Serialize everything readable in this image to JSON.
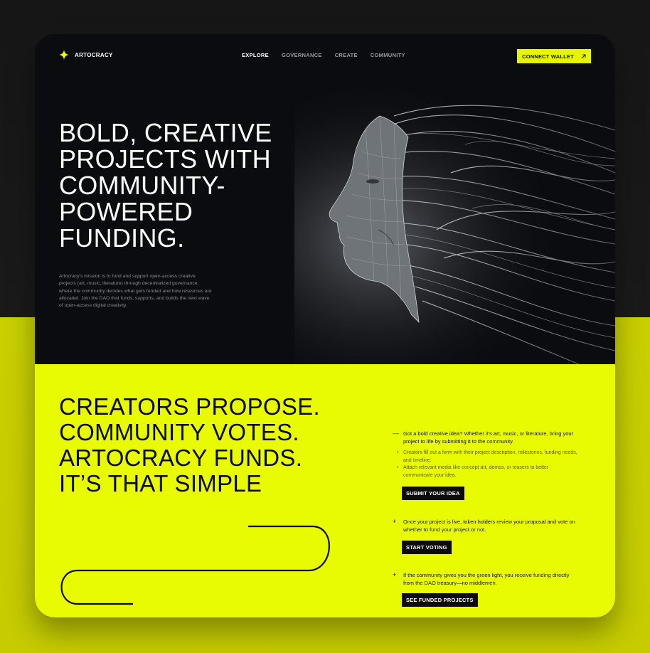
{
  "brand": {
    "name": "ARTOCRACY",
    "icon": "four-point-star-icon",
    "accent_color": "#e8fb00"
  },
  "nav": {
    "links": [
      {
        "label": "EXPLORE",
        "active": true
      },
      {
        "label": "GOVERNANCE",
        "active": false
      },
      {
        "label": "CREATE",
        "active": false
      },
      {
        "label": "COMMUNITY",
        "active": false
      }
    ],
    "cta_label": "CONNECT WALLET",
    "cta_icon": "arrow-up-right-icon"
  },
  "hero": {
    "headline_lines": [
      "BOLD, CREATIVE",
      "PROJECTS WITH",
      "COMMUNITY-",
      "POWERED",
      "FUNDING."
    ],
    "description": "Artocracy's mission is to fund and support open-access creative projects (art, music, literature) through decentralized governance, where the community decides what gets funded and how resources are allocated. Join the DAO that funds, supports, and builds the next wave of open-access digital creativity.",
    "image": "flowing-hair-portrait-illustration"
  },
  "process": {
    "tagline_lines": [
      "CREATORS PROPOSE.",
      "COMMUNITY VOTES.",
      "ARTOCRACY FUNDS.",
      "IT’S THAT SIMPLE"
    ],
    "steps": [
      {
        "marker": "—",
        "text": "Got a bold creative idea? Whether it's art, music, or literature, bring your project to life by submitting it to the community.",
        "bullets": [
          "Creators fill out a form with their project description, milestones, funding needs, and timeline.",
          "Attach relevant media like concept art, demos, or teasers to better communicate your idea."
        ],
        "button": "SUBMIT YOUR IDEA"
      },
      {
        "marker": "+",
        "text": "Once your project is live, token holders review your proposal and vote on whether to fund your project or not.",
        "bullets": [],
        "button": "START VOTING"
      },
      {
        "marker": "+",
        "text": "If the community gives you the green light, you receive funding directly from the DAO treasury—no middlemen.",
        "bullets": [],
        "button": "SEE FUNDED PROJECTS"
      }
    ]
  }
}
